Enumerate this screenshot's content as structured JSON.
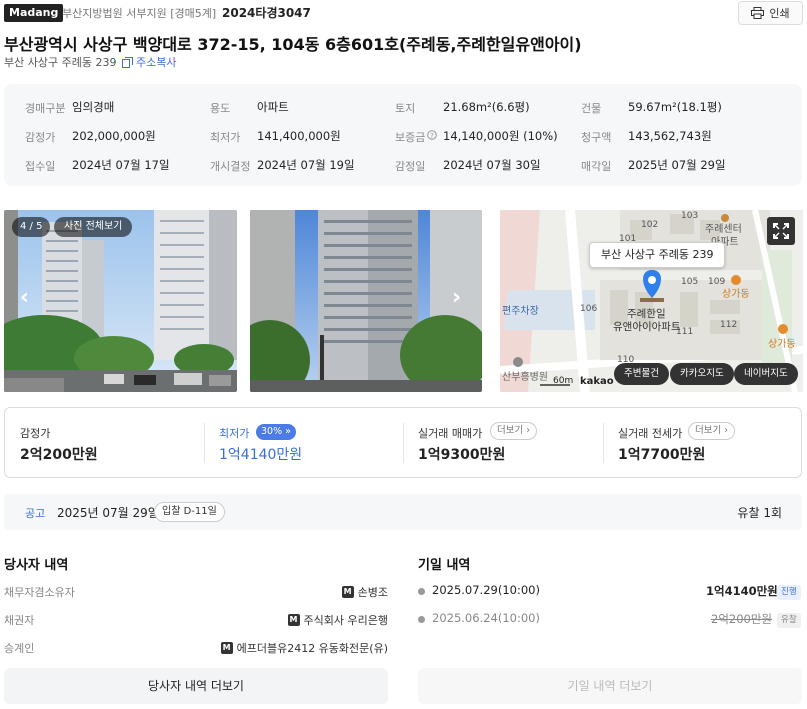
{
  "header": {
    "logo": "Madang",
    "court": "부산지방법원 서부지원 [경매5계]",
    "case_no": "2024타경3047",
    "print_label": "인쇄",
    "title": "부산광역시 사상구 백양대로 372-15, 104동 6층601호(주례동,주례한일유앤아이)",
    "sub_address": "부산 사상구 주례동 239",
    "copy_label": "주소복사"
  },
  "info": {
    "r1": [
      {
        "label": "경매구분",
        "value": "임의경매"
      },
      {
        "label": "용도",
        "value": "아파트"
      },
      {
        "label": "토지",
        "value": "21.68m²(6.6평)"
      },
      {
        "label": "건물",
        "value": "59.67m²(18.1평)"
      }
    ],
    "r2": [
      {
        "label": "감정가",
        "value": "202,000,000원"
      },
      {
        "label": "최저가",
        "value": "141,400,000원"
      },
      {
        "label": "보증금",
        "value": "14,140,000원 (10%)"
      },
      {
        "label": "청구액",
        "value": "143,562,743원"
      }
    ],
    "r3": [
      {
        "label": "접수일",
        "value": "2024년 07월 17일"
      },
      {
        "label": "개시결정",
        "value": "2024년 07월 19일"
      },
      {
        "label": "감정일",
        "value": "2024년 07월 30일"
      },
      {
        "label": "매각일",
        "value": "2025년 07월 29일"
      }
    ]
  },
  "gallery": {
    "counter": "4 / 5",
    "all_photos": "사진 전체보기"
  },
  "map": {
    "tooltip": "부산 사상구 주례동 239",
    "buttons": [
      "주변물건",
      "카카오지도",
      "네이버지도"
    ],
    "scale": "60m",
    "brand": "kakao",
    "labels": {
      "center": "주례센터",
      "apt": "아파트",
      "complex1": "주례한일",
      "complex2": "유앤아이아파트",
      "shop": "상가동",
      "shop2": "상가동",
      "parking": "편주차장",
      "hospital": "산부흥병원",
      "n102": "102",
      "n103": "103",
      "n101": "101",
      "n105": "105",
      "n106": "106",
      "n109": "109",
      "n112": "112",
      "n111": "111",
      "n110": "110"
    }
  },
  "prices": [
    {
      "label": "감정가",
      "value": "2억200만원"
    },
    {
      "label": "최저가",
      "value": "1억4140만원",
      "pct": "30%"
    },
    {
      "label": "실거래 매매가",
      "value": "1억9300만원",
      "more": "더보기"
    },
    {
      "label": "실거래 전세가",
      "value": "1억7700만원",
      "more": "더보기"
    }
  ],
  "notice": {
    "label": "공고",
    "date": "2025년 07월 29일",
    "dday": "입찰 D-11일",
    "fail": "유찰 1회"
  },
  "parties": {
    "title": "당사자 내역",
    "rows": [
      {
        "label": "채무자겸소유자",
        "value": "손병조"
      },
      {
        "label": "채권자",
        "value": "주식회사 우리은행"
      },
      {
        "label": "승계인",
        "value": "에프더블유2412 유동화전문(유)"
      }
    ],
    "more": "당사자 내역 더보기"
  },
  "dates": {
    "title": "기일 내역",
    "rows": [
      {
        "date": "2025.07.29(10:00)",
        "price": "1억4140만원",
        "status": "진행"
      },
      {
        "date": "2025.06.24(10:00)",
        "price": "2억200만원",
        "status": "유찰"
      }
    ],
    "more": "기일 내역 더보기"
  },
  "colors": {
    "accent": "#3a6fd8",
    "pin": "#2f80ed"
  }
}
